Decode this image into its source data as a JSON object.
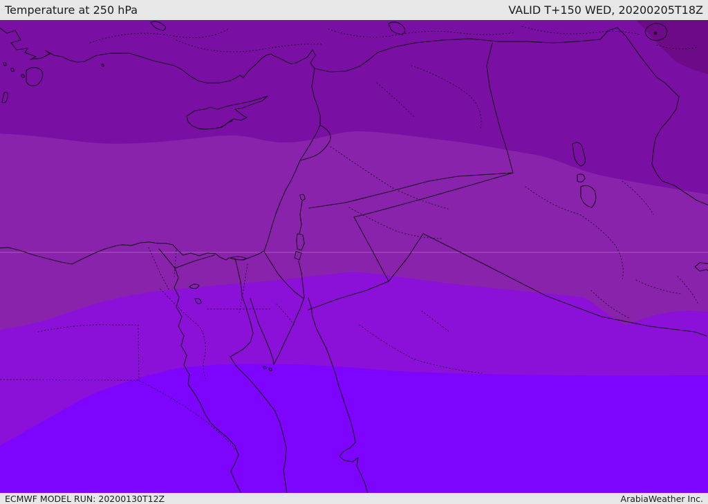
{
  "header": {
    "title": "Temperature at 250 hPa",
    "validity": "VALID T+150 WED, 20200205T18Z"
  },
  "footer": {
    "model_run": "ECMWF MODEL RUN: 20200130T12Z",
    "credit": "ArabiaWeather Inc."
  },
  "map": {
    "parameter": "Temperature",
    "level_hpa": "250",
    "region": "Eastern Mediterranean / Middle East",
    "colors": {
      "band_coldest": "#6c0a87",
      "band_cold": "#7a0fa3",
      "band_mid": "#8a23ac",
      "band_warm": "#8b10d8",
      "band_warmest": "#7d04fd",
      "outline": "#1a0420",
      "graticule": "#d08ade"
    },
    "temperature_bands": [
      {
        "position": "north-east corner",
        "color": "#6c0a87"
      },
      {
        "position": "northern band",
        "color": "#7a0fa3"
      },
      {
        "position": "central band",
        "color": "#8a23ac"
      },
      {
        "position": "southern band",
        "color": "#8b10d8"
      },
      {
        "position": "far south band",
        "color": "#7d04fd"
      }
    ]
  }
}
